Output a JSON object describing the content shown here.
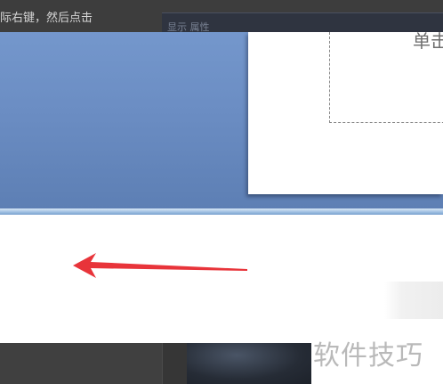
{
  "caption": {
    "text": "际右键，然后点击"
  },
  "menu_strip": {
    "text": "显示  属性"
  },
  "slide": {
    "placeholder_text": "单击"
  },
  "watermark": {
    "text": "软件技巧"
  },
  "colors": {
    "workspace_blue": "#6b8dc3",
    "arrow_red": "#e8343a",
    "dark_bar": "#3d3d3d"
  },
  "icons": {
    "pointer": "red-arrow-icon"
  }
}
